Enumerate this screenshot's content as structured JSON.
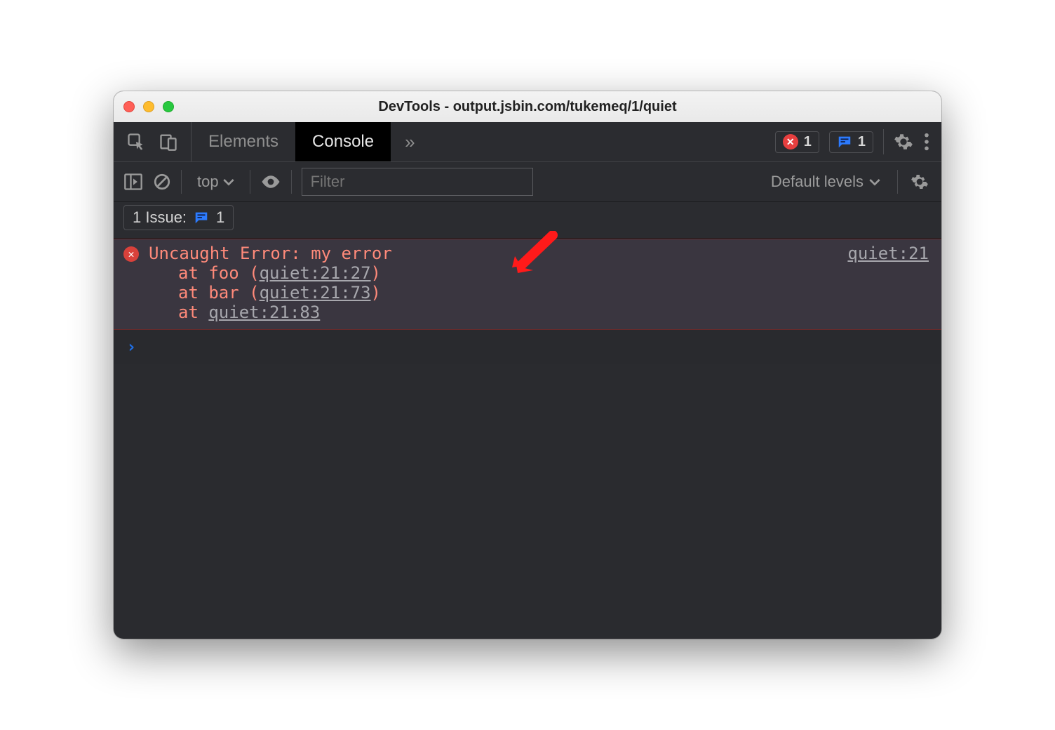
{
  "window": {
    "title": "DevTools - output.jsbin.com/tukemeq/1/quiet"
  },
  "tabs": {
    "elements": "Elements",
    "console": "Console",
    "more_glyph": "»"
  },
  "counters": {
    "error_count": "1",
    "issue_count": "1"
  },
  "toolbar": {
    "context": "top",
    "filter_placeholder": "Filter",
    "levels": "Default levels"
  },
  "issues": {
    "label": "1 Issue:",
    "count": "1"
  },
  "error": {
    "message": "Uncaught Error: my error",
    "source": "quiet:21",
    "stack": [
      {
        "prefix": "at foo (",
        "loc": "quiet:21:27",
        "suffix": ")"
      },
      {
        "prefix": "at bar (",
        "loc": "quiet:21:73",
        "suffix": ")"
      },
      {
        "prefix": "at ",
        "loc": "quiet:21:83",
        "suffix": ""
      }
    ]
  },
  "prompt": {
    "glyph": "›"
  }
}
